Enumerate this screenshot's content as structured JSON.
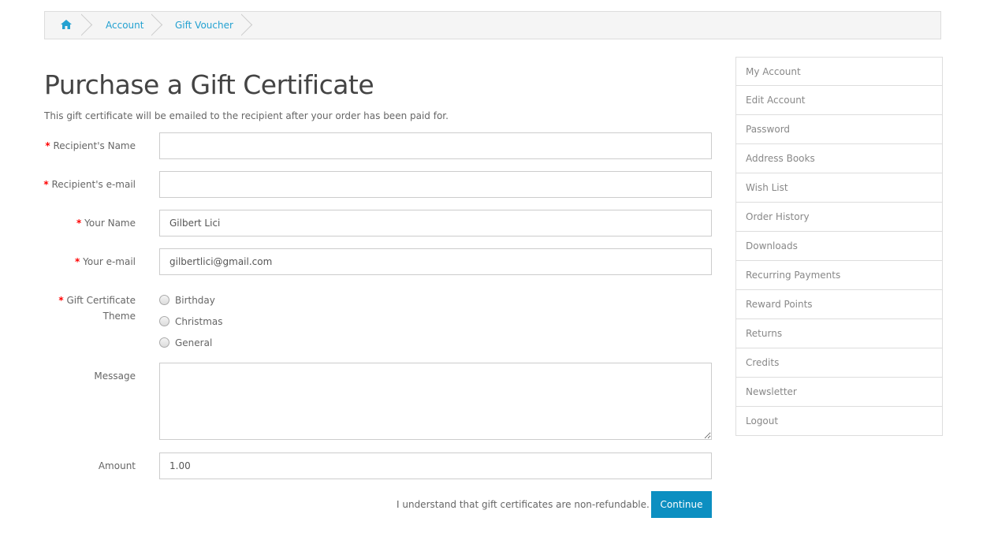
{
  "breadcrumb": {
    "home_icon": "home-icon",
    "items": [
      "Account",
      "Gift Voucher"
    ],
    "color": "#23a1d1"
  },
  "page": {
    "title": "Purchase a Gift Certificate",
    "intro": "This gift certificate will be emailed to the recipient after your order has been paid for."
  },
  "form": {
    "required_mark": "*",
    "recipient_name": {
      "label": "Recipient's Name",
      "value": ""
    },
    "recipient_email": {
      "label": "Recipient's e-mail",
      "value": ""
    },
    "your_name": {
      "label": "Your Name",
      "value": "Gilbert Lici"
    },
    "your_email": {
      "label": "Your e-mail",
      "value": "gilbertlici@gmail.com"
    },
    "theme": {
      "label_line1": "Gift Certificate",
      "label_line2": "Theme",
      "options": [
        "Birthday",
        "Christmas",
        "General"
      ]
    },
    "message": {
      "label": "Message",
      "value": ""
    },
    "amount": {
      "label": "Amount",
      "value": "1.00"
    },
    "agree_text": "I understand that gift certificates are non-refundable.",
    "continue_label": "Continue",
    "accent": "#0c8fc1"
  },
  "sidebar": {
    "items": [
      "My Account",
      "Edit Account",
      "Password",
      "Address Books",
      "Wish List",
      "Order History",
      "Downloads",
      "Recurring Payments",
      "Reward Points",
      "Returns",
      "Credits",
      "Newsletter",
      "Logout"
    ]
  }
}
